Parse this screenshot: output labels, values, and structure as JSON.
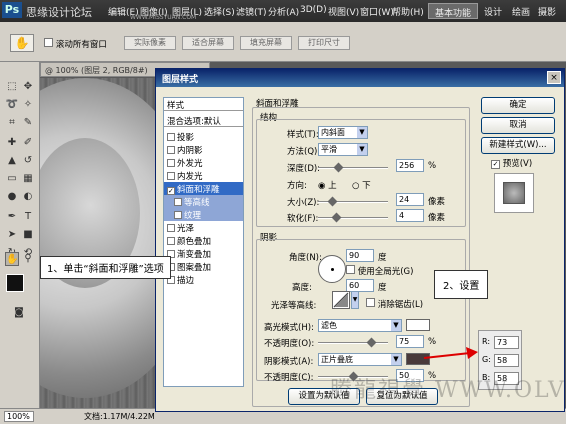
{
  "menubar": {
    "site_title": "思缘设计论坛",
    "menus": [
      "编辑(E)",
      "图像(I)",
      "图层(L)",
      "选择(S)",
      "滤镜(T)",
      "分析(A)",
      "3D(D)",
      "视图(V)",
      "窗口(W)",
      "帮助(H)"
    ],
    "watermark_url": "WWW.MISSYUAN.COM",
    "workspaces": [
      "基本功能",
      "设计",
      "绘画",
      "摄影"
    ],
    "window_controls": [
      "–",
      "□",
      "×"
    ]
  },
  "options": {
    "scroll_all_windows": "滚动所有窗口",
    "buttons": [
      "实际像素",
      "适合屏幕",
      "填充屏幕",
      "打印尺寸"
    ]
  },
  "document": {
    "tab_title": "@ 100% (图层 2, RGB/8#)",
    "zoom": "100%",
    "doc_size": "文档:1.17M/4.22M"
  },
  "dialog": {
    "title": "图层样式",
    "styles_header": "样式",
    "blend_options": "混合选项:默认",
    "style_items": [
      {
        "label": "投影",
        "checked": false
      },
      {
        "label": "内阴影",
        "checked": false
      },
      {
        "label": "外发光",
        "checked": false
      },
      {
        "label": "内发光",
        "checked": false
      },
      {
        "label": "斜面和浮雕",
        "checked": true
      },
      {
        "label": "等高线",
        "checked": false
      },
      {
        "label": "纹理",
        "checked": false
      },
      {
        "label": "光泽",
        "checked": false
      },
      {
        "label": "颜色叠加",
        "checked": false
      },
      {
        "label": "渐变叠加",
        "checked": false
      },
      {
        "label": "图案叠加",
        "checked": false
      },
      {
        "label": "描边",
        "checked": false
      }
    ],
    "bevel_title": "斜面和浮雕",
    "structure_title": "结构",
    "style_label": "样式(T):",
    "style_value": "内斜面",
    "technique_label": "方法(Q):",
    "technique_value": "平滑",
    "depth_label": "深度(D):",
    "depth_value": "256",
    "depth_unit": "%",
    "direction_label": "方向:",
    "direction_up": "上",
    "direction_down": "下",
    "size_label": "大小(Z):",
    "size_value": "24",
    "size_unit": "像素",
    "soften_label": "软化(F):",
    "soften_value": "4",
    "soften_unit": "像素",
    "shading_title": "阴影",
    "angle_label": "角度(N):",
    "angle_value": "90",
    "angle_unit": "度",
    "global_light": "使用全局光(G)",
    "altitude_label": "高度:",
    "altitude_value": "60",
    "altitude_unit": "度",
    "gloss_label": "光泽等高线:",
    "anti_alias": "消除锯齿(L)",
    "highlight_mode_label": "高光模式(H):",
    "highlight_mode_value": "滤色",
    "highlight_opacity_label": "不透明度(O):",
    "highlight_opacity_value": "75",
    "highlight_color": "#ffffff",
    "shadow_mode_label": "阴影模式(A):",
    "shadow_mode_value": "正片叠底",
    "shadow_opacity_label": "不透明度(C):",
    "shadow_opacity_value": "50",
    "shadow_color": "#493a3a",
    "percent": "%",
    "set_default": "设置为默认值",
    "reset_default": "复位为默认值",
    "ok": "确定",
    "cancel": "取消",
    "new_style": "新建样式(W)...",
    "preview": "预览(V)"
  },
  "rgb": {
    "r_label": "R:",
    "r": "73",
    "g_label": "G:",
    "g": "58",
    "b_label": "B:",
    "b": "58"
  },
  "callouts": {
    "step1": "1、单击“斜面和浮雕”选项",
    "step2": "2、设置"
  },
  "watermark": "腾龍視覺 WWW.OLVL.NET",
  "slider_levels": {
    "depth": 0.28,
    "size": 0.2,
    "soften": 0.25,
    "highlight_opacity": 0.75,
    "shadow_opacity": 0.5
  }
}
